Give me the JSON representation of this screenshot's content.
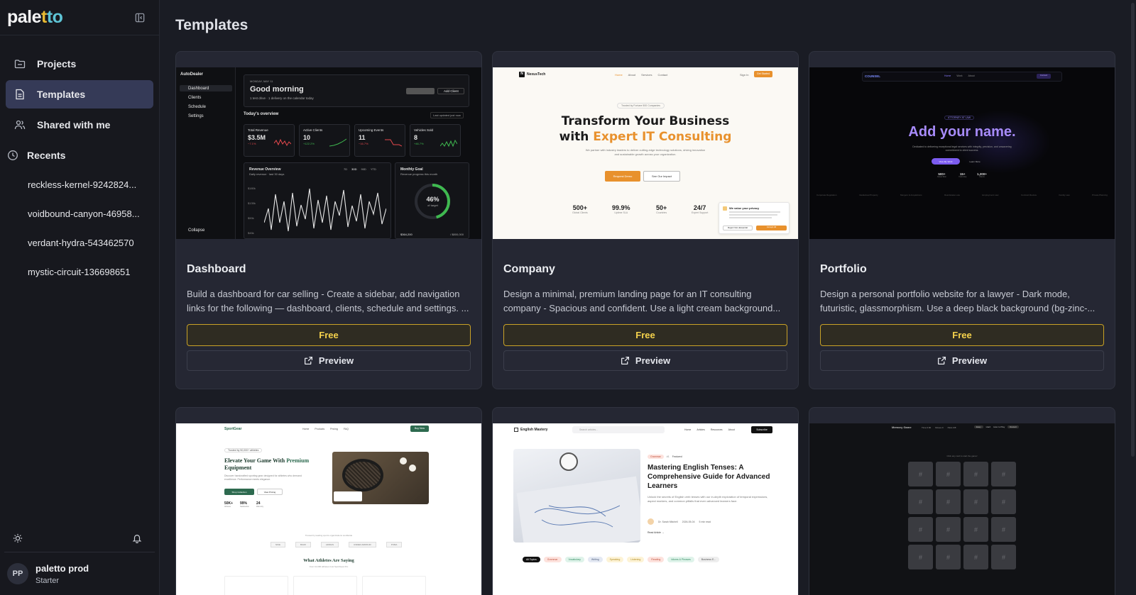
{
  "app": {
    "logo_parts": [
      "pale",
      "t",
      "to"
    ]
  },
  "sidebar": {
    "items": [
      {
        "label": "Projects",
        "icon": "folder-icon"
      },
      {
        "label": "Templates",
        "icon": "template-icon",
        "active": true
      },
      {
        "label": "Shared with me",
        "icon": "users-icon"
      }
    ],
    "recents_label": "Recents",
    "recents": [
      "reckless-kernel-9242824...",
      "voidbound-canyon-46958...",
      "verdant-hydra-543462570",
      "mystic-circuit-136698651"
    ]
  },
  "user": {
    "initials": "PP",
    "name": "paletto prod",
    "plan": "Starter"
  },
  "page": {
    "title": "Templates"
  },
  "cards": [
    {
      "title": "Dashboard",
      "description": "Build a dashboard for car selling - Create a sidebar, add navigation links for the following — dashboard, clients, schedule and settings. ...",
      "free_label": "Free",
      "preview_label": "Preview"
    },
    {
      "title": "Company",
      "description": "Design a minimal, premium landing page for an IT consulting company - Spacious and confident. Use a light cream background...",
      "free_label": "Free",
      "preview_label": "Preview"
    },
    {
      "title": "Portfolio",
      "description": "Design a personal portfolio website for a lawyer - Dark mode, futuristic, glassmorphism. Use a deep black background (bg-zinc-...",
      "free_label": "Free",
      "preview_label": "Preview"
    }
  ],
  "thumbs": {
    "dash": {
      "brand": "AutoDealer",
      "nav": [
        "Dashboard",
        "Clients",
        "Schedule",
        "Settings"
      ],
      "collapse": "Collapse",
      "date": "MONDAY, MAY 11",
      "greeting": "Good morning",
      "sub": "1 test drive · 1 delivery on the calendar today",
      "add_btn": "Add Client",
      "overview": "Today's overview",
      "updated": "Last updated just now",
      "stats": [
        {
          "label": "Total Revenue",
          "value": "$3.5M",
          "delta": "−7.1%"
        },
        {
          "label": "Active Clients",
          "value": "10",
          "delta": "+122.2%"
        },
        {
          "label": "Upcoming Events",
          "value": "11",
          "delta": "−16.7%"
        },
        {
          "label": "Vehicles Sold",
          "value": "8",
          "delta": "+46.7%"
        }
      ],
      "rev_title": "Revenue Overview",
      "rev_sub": "Daily revenue · last 30 days",
      "rev_ticks": [
        "$180k",
        "$135k",
        "$90k",
        "$45k"
      ],
      "rev_tabs": [
        "7D",
        "30D",
        "90D",
        "YTD"
      ],
      "goal_title": "Monthly Goal",
      "goal_sub": "Revenue progress this month",
      "goal_pct": "46%",
      "goal_pct_value": 0.46,
      "goal_of": "of target",
      "goal_left": "$364,200",
      "goal_right": "/ $800,000"
    },
    "company": {
      "brand": "NexusTech",
      "nav": [
        "Home",
        "About",
        "Services",
        "Contact"
      ],
      "signin": "Sign In",
      "cta": "Get Started",
      "badge": "Trusted by Fortune 500 Companies",
      "hero1": "Transform Your Business",
      "hero2_pre": "with ",
      "hero2_accent": "Expert IT Consulting",
      "body": "We partner with industry leaders to deliver cutting-edge technology solutions, driving innovation and sustainable growth across your organization.",
      "btn1": "Request Demo",
      "btn2": "See Our Impact",
      "stats": [
        {
          "v": "500+",
          "l": "Global Clients"
        },
        {
          "v": "99.9%",
          "l": "Uptime SLA"
        },
        {
          "v": "50+",
          "l": "Countries"
        },
        {
          "v": "24/7",
          "l": "Expert Support"
        }
      ],
      "cookie_title": "We value your privacy",
      "cookie_reject": "Reject Non-Essential",
      "cookie_accept": "Accept All"
    },
    "portfolio": {
      "brand": "COUNSEL",
      "nav": [
        "Home",
        "Work",
        "About"
      ],
      "contact": "Contact",
      "badge": "ATTORNEY AT LAW",
      "hero": "Add your name.",
      "body": "Dedicated to delivering exceptional legal services with integrity, precision, and unwavering commitment to client success.",
      "btn1": "View My Work",
      "btn2": "Learn More",
      "stats": [
        {
          "v": "500+",
          "l": "Cases Won"
        },
        {
          "v": "15+",
          "l": "Years Exp"
        },
        {
          "v": "1,200+",
          "l": "Clients"
        }
      ],
      "areas": [
        "Corporate Regulation",
        "Intellectual Property",
        "Mergers & Acquisitions",
        "Real Estate Law",
        "Employment Law",
        "Contract Review",
        "Family Law",
        "Private Planning"
      ]
    },
    "sport": {
      "brand": "SportGear",
      "nav": [
        "Home",
        "Products",
        "Pricing",
        "FAQ"
      ],
      "cta": "Buy Now",
      "badge": "Trusted by 50,000+ athletes",
      "hero1": "Elevate Your Game With ",
      "hero_accent": "Premium",
      "hero2": "Equipment",
      "body": "Discover handcrafted sporting gear designed for athletes who demand excellence. Performance meets elegance.",
      "btn1": "Shop Collection",
      "btn2": "View Pricing",
      "stats": [
        {
          "v": "50K+",
          "l": "Athletes"
        },
        {
          "v": "99%",
          "l": "Satisfaction"
        },
        {
          "v": "24",
          "l": "Warranty"
        }
      ],
      "trusted": "Trusted by leading sports organizations worldwide",
      "logos": [
        "NIKE",
        "BUZZ",
        "ADIDAS",
        "UNDER ARMOUR",
        "PUMA"
      ],
      "section": "What Athletes Are Saying",
      "section_sub": "Over 10,000 athletes trust SportGear Pro"
    },
    "english": {
      "brand": "English Mastery",
      "search": "Search articles...",
      "nav": [
        "Home",
        "Articles",
        "Resources",
        "About"
      ],
      "subscribe": "Subscribe",
      "tag": "Grammar",
      "read_time": "#1",
      "featured": "Featured",
      "title": "Mastering English Tenses: A Comprehensive Guide for Advanced Learners",
      "body": "Unlock the secrets of English verb tenses with our in-depth exploration of temporal expressions, aspect markers, and common pitfalls that even advanced learners face.",
      "author": "Dr. Sarah Mitchell",
      "date": "2026-05-04",
      "mins": "5 min read",
      "read": "Read Article →",
      "chips": [
        "All Topics",
        "Grammar",
        "Vocabulary",
        "Writing",
        "Speaking",
        "Listening",
        "Reading",
        "Idioms & Phrases",
        "Business E..."
      ]
    },
    "memory": {
      "title": "Memory Game",
      "stats": [
        "Time 0:00",
        "Moves 0",
        "Pairs 0/8"
      ],
      "btns": [
        "Easy",
        "Hard",
        "How to Play",
        "Restart"
      ],
      "hint": "Click any card to start the game!",
      "card_count": 16
    }
  }
}
